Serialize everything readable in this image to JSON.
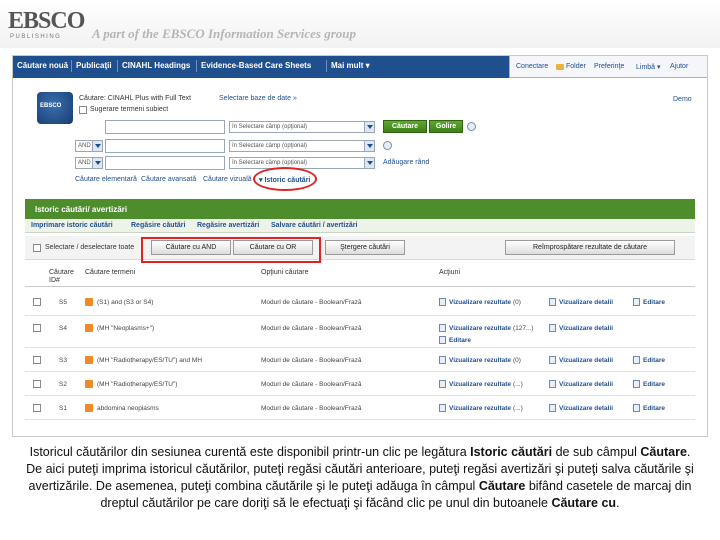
{
  "header": {
    "logo_text": "EBSCO",
    "logo_sub": "PUBLISHING",
    "tagline": "A part of the EBSCO Information Services group"
  },
  "topnav": {
    "items": [
      "Căutare nouă",
      "Publicaţii",
      "CINAHL Headings",
      "Evidence-Based Care Sheets",
      "Mai mult ▾"
    ],
    "right": [
      "Conectare",
      "Folder",
      "Preferinţe",
      "Limbă ▾",
      "Ajutor"
    ]
  },
  "search": {
    "db_logo": "EBSCO",
    "searching_label": "Căutare: CINAHL Plus with Full Text",
    "choose_db": "Selectare baze de date »",
    "suggest": "Sugerare termeni subiect",
    "demo": "Demo",
    "rows": [
      {
        "bool": "",
        "field": "în  Selectare câmp (opţional)"
      },
      {
        "bool": "AND",
        "field": "în  Selectare câmp (opţional)"
      },
      {
        "bool": "AND",
        "field": "în  Selectare câmp (opţional)"
      }
    ],
    "search_btn": "Căutare",
    "clear_btn": "Golire",
    "add_row": "Adăugare rând",
    "mode_links": [
      "Căutare elementară",
      "Căutare avansată",
      "Căutare vizuală",
      "▾ Istoric căutări"
    ]
  },
  "history": {
    "title": "Istoric căutări/ avertizări",
    "links": [
      "Imprimare istoric căutări",
      "Regăsire căutări",
      "Regăsire avertizări",
      "Salvare căutări / avertizări"
    ],
    "select_all": "Selectare / deselectare toate",
    "btn_and": "Căutare cu AND",
    "btn_or": "Căutare cu OR",
    "btn_delete": "Ştergere căutări",
    "btn_refresh": "Reîmprospătare rezultate de căutare",
    "columns": {
      "id": "Căutare ID#",
      "terms": "Căutare termeni",
      "options": "Opţiuni căutare",
      "actions": "Acţiuni"
    },
    "rows": [
      {
        "id": "S5",
        "terms": "(S1) and (S3 or S4)",
        "options": "Moduri de căutare - Boolean/Frază",
        "view": "Vizualizare rezultate",
        "count": "(0)",
        "details": "Vizualizare detalii",
        "edit": "Editare"
      },
      {
        "id": "S4",
        "terms": "(MH \"Neoplasms+\")",
        "options": "Moduri de căutare - Boolean/Frază",
        "view": "Vizualizare rezultate",
        "count": "(127...)",
        "details": "Vizualizare detalii",
        "edit": "Editare"
      },
      {
        "id": "S3",
        "terms": "(MH \"Radiotherapy/ES/TU\") and MH",
        "options": "Moduri de căutare - Boolean/Frază",
        "view": "Vizualizare rezultate",
        "count": "(0)",
        "details": "Vizualizare detalii",
        "edit": "Editare"
      },
      {
        "id": "S2",
        "terms": "(MH \"Radiotherapy/ES/TU\")",
        "options": "Moduri de căutare - Boolean/Frază",
        "view": "Vizualizare rezultate",
        "count": "(...)",
        "details": "Vizualizare detalii",
        "edit": "Editare"
      },
      {
        "id": "S1",
        "terms": "abdomina neoplasms",
        "options": "Moduri de căutare - Boolean/Frază",
        "view": "Vizualizare rezultate",
        "count": "(...)",
        "details": "Vizualizare detalii",
        "edit": "Editare"
      }
    ]
  },
  "caption": {
    "p1": "Istoricul căutărilor din sesiunea curentă este disponibil printr-un clic pe legătura ",
    "b1": "Istoric căutări",
    "p2": " de sub câmpul ",
    "b2": "Căutare",
    "p3": ". De aici puteţi imprima istoricul căutărilor, puteţi regăsi căutări anterioare, puteţi regăsi avertizări şi puteţi salva căutările şi avertizările. De asemenea, puteţi combina căutările şi le puteţi adăuga în câmpul ",
    "b3": "Căutare",
    "p4": " bifând casetele de marcaj din dreptul căutărilor pe care doriţi să le efectuaţi şi făcând clic pe unul din butoanele ",
    "b4": "Căutare cu",
    "p5": "."
  },
  "colors": {
    "nav": "#1f4f8d",
    "history_bar": "#4d8d2c",
    "annotation": "#e22222"
  }
}
